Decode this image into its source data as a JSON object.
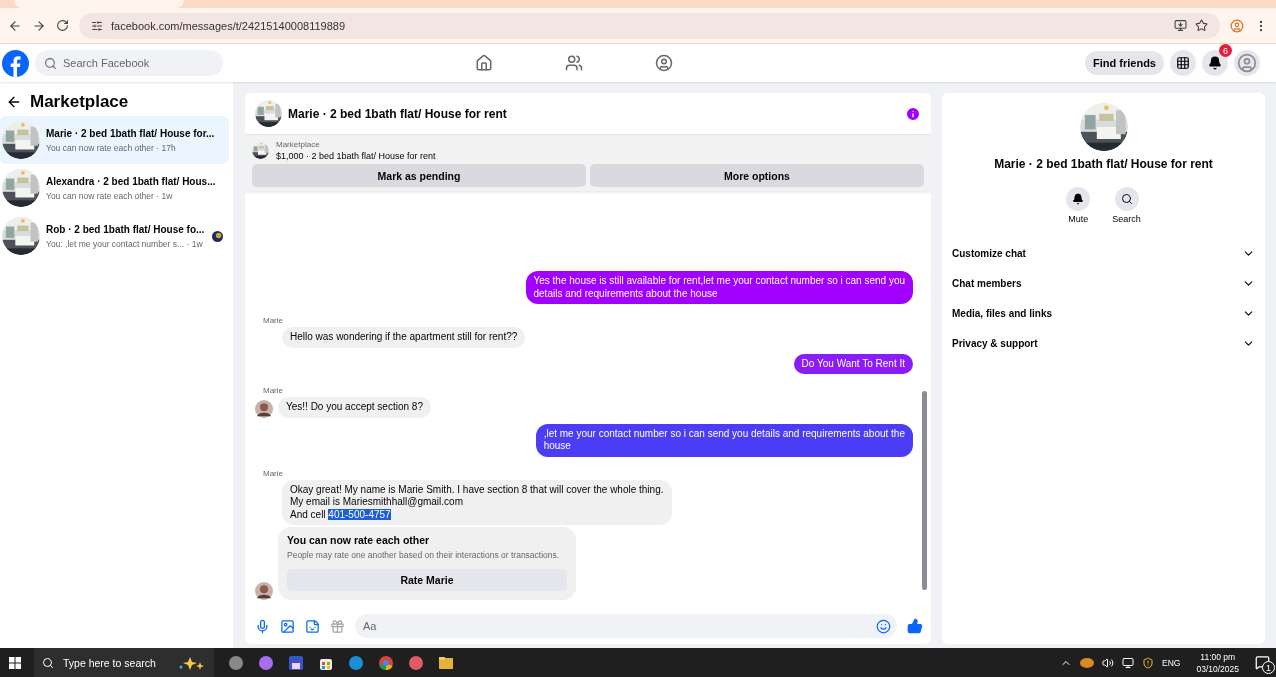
{
  "browser": {
    "url": "facebook.com/messages/t/24215140008119889"
  },
  "header": {
    "search_placeholder": "Search Facebook",
    "find_friends": "Find friends",
    "notification_count": "6"
  },
  "sidebar": {
    "title": "Marketplace",
    "conversations": [
      {
        "title": "Marie · 2 bed 1bath flat/ House for...",
        "preview": "You can now rate each other · 17h",
        "selected": true,
        "seen": false
      },
      {
        "title": "Alexandra · 2 bed 1bath flat/ Hous...",
        "preview": "You can now rate each other · 1w",
        "selected": false,
        "seen": false
      },
      {
        "title": "Rob · 2 bed 1bath flat/ House fo...",
        "preview": "You: ,let me your contact number s... · 1w",
        "selected": false,
        "seen": true
      }
    ]
  },
  "chat": {
    "title": "Marie · 2 bed 1bath flat/ House for rent",
    "listing": {
      "label": "Marketplace",
      "title": "$1,000 · 2 bed 1bath flat/ House for rent"
    },
    "actions": [
      "Mark as pending",
      "More options"
    ],
    "messages": [
      {
        "kind": "outgoing",
        "color": "#a100ff",
        "lines": [
          {
            "text": "Yes the house is still available for rent,let me your contact number so i can send you"
          },
          {
            "text": "details and requirements about the house"
          }
        ]
      },
      {
        "kind": "incoming",
        "sender": "Marie",
        "avatar": false,
        "lines": [
          {
            "text": "Hello was wondering if the apartment still for rent??"
          }
        ]
      },
      {
        "kind": "outgoing",
        "color": "#8a1cf5",
        "lines": [
          {
            "text": "Do You Want To Rent It"
          }
        ]
      },
      {
        "kind": "incoming",
        "sender": "Marie",
        "avatar": true,
        "lines": [
          {
            "text": "Yes!! Do you accept section 8?"
          }
        ]
      },
      {
        "kind": "outgoing",
        "color": "#4b3cf5",
        "lines": [
          {
            "text": ",let me your contact number so i can send you details and requirements about the"
          },
          {
            "text": "house"
          }
        ]
      },
      {
        "kind": "incoming",
        "sender": "Marie",
        "avatar": false,
        "lines": [
          {
            "text": "Okay great! My name is Marie Smith. I have section 8 that will cover the whole thing."
          },
          {
            "text": "My email is Mariesmithhall@gmail.com"
          },
          {
            "text": "And cell ",
            "selection": "401-500-4757"
          }
        ]
      },
      {
        "kind": "rating",
        "avatar": true,
        "title": "You can now rate each other",
        "text": "People may rate one another based on their interactions or transactions.",
        "button": "Rate Marie"
      }
    ],
    "composer_placeholder": "Aa"
  },
  "details": {
    "title": "Marie · 2 bed 1bath flat/ House for rent",
    "actions": [
      "Mute",
      "Search"
    ],
    "sections": [
      "Customize chat",
      "Chat members",
      "Media, files and links",
      "Privacy & support"
    ]
  },
  "taskbar": {
    "search_placeholder": "Type here to search",
    "language": "ENG",
    "time": "11:00 pm",
    "date": "03/10/2025",
    "notification_count": "1"
  }
}
